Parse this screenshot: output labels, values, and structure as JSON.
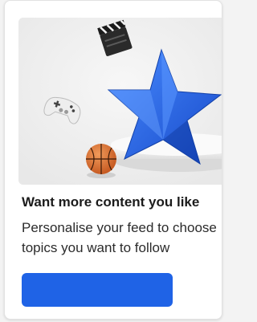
{
  "card": {
    "title": "Want more content you like",
    "description_line1": "Personalise your feed to choose",
    "description_line2": "topics you want to follow",
    "cta_label": ""
  },
  "colors": {
    "accent": "#1f63e6",
    "star": "#1f63e6",
    "hero_background": "#efefef"
  },
  "hero": {
    "icons": [
      "clapperboard-icon",
      "game-controller-icon",
      "basketball-icon",
      "star-icon"
    ]
  }
}
